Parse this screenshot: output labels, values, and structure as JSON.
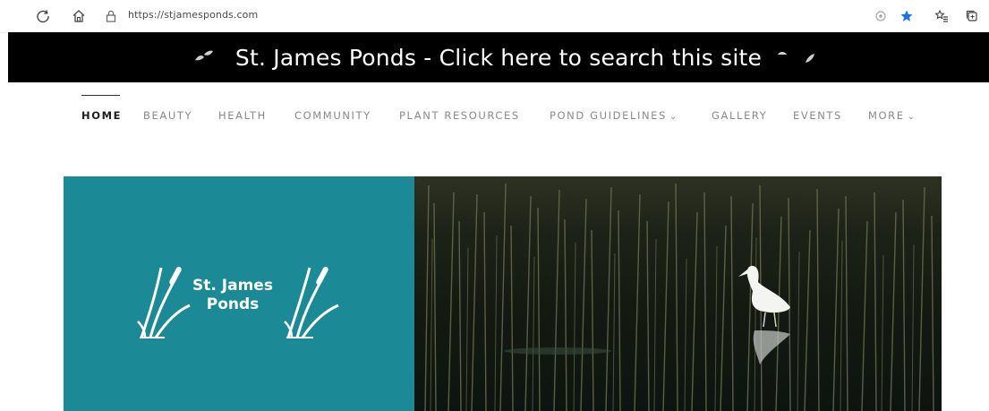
{
  "browser": {
    "url": "https://stjamesponds.com",
    "icons": [
      "refresh-icon",
      "home-icon",
      "lock-icon",
      "reader-icon",
      "star-icon",
      "favorites-icon",
      "collections-icon"
    ]
  },
  "banner": {
    "text": "St. James Ponds - Click here to search this site"
  },
  "nav": {
    "items": [
      {
        "label": "HOME",
        "active": true
      },
      {
        "label": "BEAUTY"
      },
      {
        "label": "HEALTH"
      },
      {
        "label": "COMMUNITY"
      },
      {
        "label": "PLANT RESOURCES"
      },
      {
        "label": "POND GUIDELINES",
        "dropdown": true
      },
      {
        "label": "GALLERY"
      },
      {
        "label": "EVENTS"
      },
      {
        "label": "MORE",
        "dropdown": true
      }
    ]
  },
  "hero": {
    "logo_line1": "St. James",
    "logo_line2": "Ponds",
    "left_color": "#1b8a96",
    "photo": "egret-in-pond-reeds"
  },
  "colors": {
    "banner_bg": "#000000",
    "teal": "#1b8a96",
    "star": "#1a73e8"
  }
}
